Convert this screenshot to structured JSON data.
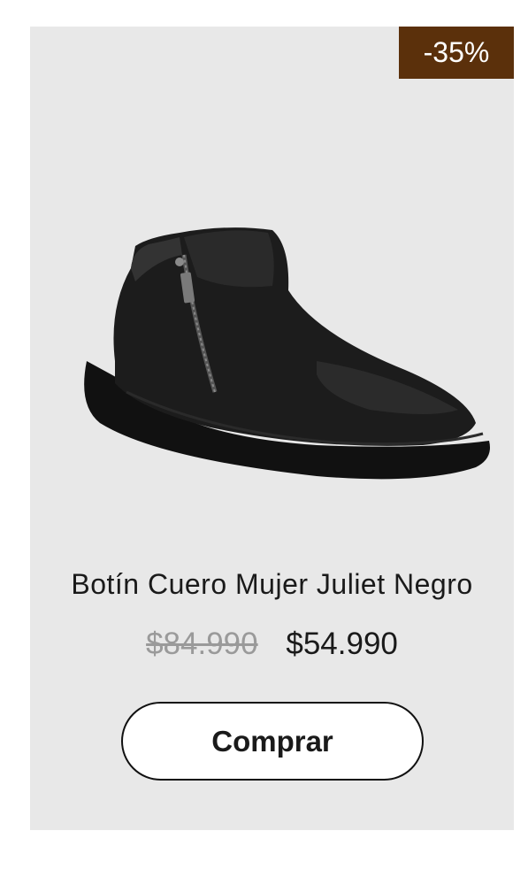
{
  "product": {
    "discount_badge": "-35%",
    "title": "Botín Cuero Mujer Juliet Negro",
    "original_price": "$84.990",
    "sale_price": "$54.990",
    "buy_label": "Comprar",
    "image_alt": "ankle-boot-image"
  },
  "colors": {
    "card_background": "#e8e8e8",
    "badge_background": "#5b300b",
    "old_price": "#9a9a9a",
    "text": "#1a1a1a"
  }
}
